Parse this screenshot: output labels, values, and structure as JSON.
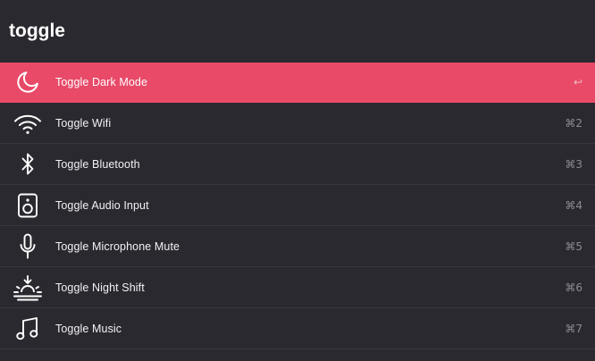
{
  "search": {
    "query": "toggle"
  },
  "colors": {
    "background": "#2a292f",
    "selected": "#e84a68",
    "divider": "#38373d",
    "label": "#f2f2f4",
    "shortcut": "#8c8b91"
  },
  "results": [
    {
      "icon": "moon-icon",
      "label": "Toggle Dark Mode",
      "shortcut": "↩",
      "selected": true
    },
    {
      "icon": "wifi-icon",
      "label": "Toggle Wifi",
      "shortcut": "⌘2"
    },
    {
      "icon": "bluetooth-icon",
      "label": "Toggle Bluetooth",
      "shortcut": "⌘3"
    },
    {
      "icon": "speaker-icon",
      "label": "Toggle Audio Input",
      "shortcut": "⌘4"
    },
    {
      "icon": "microphone-icon",
      "label": "Toggle Microphone Mute",
      "shortcut": "⌘5"
    },
    {
      "icon": "sunrise-icon",
      "label": "Toggle Night Shift",
      "shortcut": "⌘6"
    },
    {
      "icon": "music-note-icon",
      "label": "Toggle Music",
      "shortcut": "⌘7"
    }
  ]
}
